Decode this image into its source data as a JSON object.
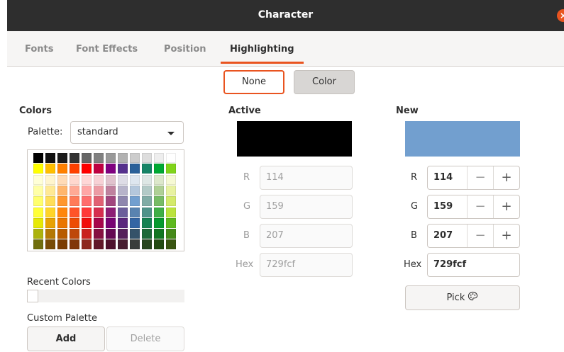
{
  "window": {
    "title": "Character",
    "close_label": "×"
  },
  "tabs": [
    {
      "label": "Fonts",
      "active": false
    },
    {
      "label": "Font Effects",
      "active": false
    },
    {
      "label": "Position",
      "active": false
    },
    {
      "label": "Highlighting",
      "active": true
    }
  ],
  "mode": {
    "none_label": "None",
    "color_label": "Color",
    "selected": "None"
  },
  "colors": {
    "heading": "Colors",
    "palette_label": "Palette:",
    "palette_value": "standard",
    "swatch_rows": [
      [
        "#000000",
        "#111111",
        "#1c1c1c",
        "#333333",
        "#666666",
        "#808080",
        "#999999",
        "#b2b2b2",
        "#cccccc",
        "#dddddd",
        "#eeeeee",
        "#ffffff"
      ],
      [
        "#ffff00",
        "#ffbf00",
        "#ff8000",
        "#ff4000",
        "#ff0000",
        "#bf0041",
        "#800080",
        "#55308d",
        "#2a6099",
        "#158466",
        "#00a933",
        "#81d41a"
      ],
      [
        "#ffffd7",
        "#fff5ce",
        "#ffdbb6",
        "#ffd8ce",
        "#ffd7d7",
        "#f7d1d5",
        "#e0c2cd",
        "#dedce6",
        "#dee6ef",
        "#dee7e5",
        "#dde8cb",
        "#f6f9d4"
      ],
      [
        "#ffffa6",
        "#ffe994",
        "#ffb66c",
        "#ffaa95",
        "#ffa6a6",
        "#ec9ba4",
        "#bf819e",
        "#b7b3ca",
        "#b4c7dc",
        "#b3cac7",
        "#afd095",
        "#e8f2a1"
      ],
      [
        "#ffff6d",
        "#ffde59",
        "#ff972f",
        "#ff7b59",
        "#ff6d6d",
        "#e16173",
        "#a1467e",
        "#8e86ae",
        "#729fcf",
        "#81aca6",
        "#77bc65",
        "#d4ea6b"
      ],
      [
        "#ffff38",
        "#ffd428",
        "#ff860d",
        "#ff5429",
        "#ff3838",
        "#d62e4e",
        "#8d1d75",
        "#6b5e9b",
        "#5983b0",
        "#50938a",
        "#3faf46",
        "#bbe33d"
      ],
      [
        "#e6e905",
        "#e8a202",
        "#ea7500",
        "#ed4c05",
        "#f10d0c",
        "#a7074b",
        "#780373",
        "#5b277d",
        "#3465a4",
        "#168253",
        "#069a2e",
        "#5eb91e"
      ],
      [
        "#acb20c",
        "#b47804",
        "#b85c00",
        "#be480a",
        "#c9211e",
        "#861141",
        "#650953",
        "#55215b",
        "#355269",
        "#1e6a39",
        "#127622",
        "#468a1a"
      ],
      [
        "#706e0c",
        "#784b04",
        "#7b3d00",
        "#813709",
        "#8d281e",
        "#611729",
        "#4e102d",
        "#481d32",
        "#383d3c",
        "#28471f",
        "#224b12",
        "#395511"
      ]
    ],
    "recent_label": "Recent Colors",
    "custom_label": "Custom Palette",
    "add_label": "Add",
    "delete_label": "Delete"
  },
  "active": {
    "heading": "Active",
    "color": "#000000",
    "r_label": "R",
    "r_value": "114",
    "g_label": "G",
    "g_value": "159",
    "b_label": "B",
    "b_value": "207",
    "hex_label": "Hex",
    "hex_value": "729fcf"
  },
  "new": {
    "heading": "New",
    "color": "#729fcf",
    "r_label": "R",
    "r_value": "114",
    "g_label": "G",
    "g_value": "159",
    "b_label": "B",
    "b_value": "207",
    "hex_label": "Hex",
    "hex_value": "729fcf",
    "minus": "−",
    "plus": "+",
    "pick_label": "Pick",
    "pick_icon": "palette-icon"
  },
  "accent_color": "#e95420"
}
